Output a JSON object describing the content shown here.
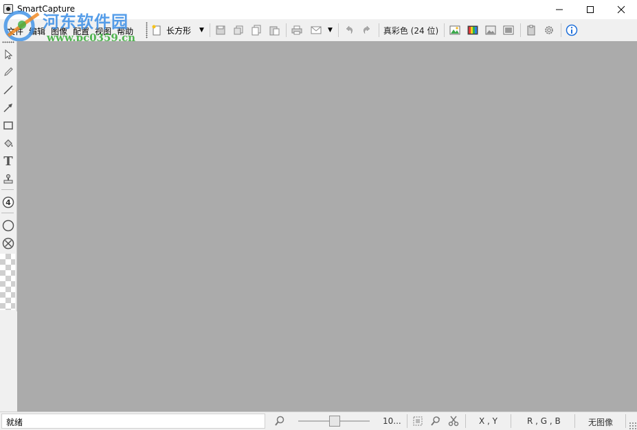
{
  "window": {
    "title": "SmartCapture",
    "controls": [
      "minimize",
      "maximize",
      "close"
    ]
  },
  "watermark": {
    "site_name": "河东软件园",
    "url": "www.pc0359.cn"
  },
  "menu": {
    "items": [
      "文件",
      "编辑",
      "图像",
      "配置",
      "视图",
      "帮助"
    ]
  },
  "toolbar": {
    "shape_selector": "长方形",
    "color_depth": "真彩色 (24 位)",
    "buttons": [
      "save-icon",
      "copy-all-icon",
      "copy-icon",
      "paste-icon",
      "print-icon",
      "email-icon",
      "undo-icon",
      "redo-icon",
      "image-adjust-icon",
      "color-balance-icon",
      "image-icon",
      "screen-icon",
      "clipboard-icon",
      "settings-icon",
      "info-icon"
    ]
  },
  "tools": [
    "select-arrow-icon",
    "pencil-icon",
    "line-icon",
    "arrow-icon",
    "rectangle-icon",
    "fill-bucket-icon",
    "text-icon",
    "stamp-icon",
    "number-icon",
    "circle-icon",
    "cross-circle-icon"
  ],
  "tool_number_label": "4",
  "tool_text_label": "T",
  "status": {
    "message": "就绪",
    "zoom": "10...",
    "zoom_level": 0.45,
    "coords": "X , Y",
    "rgb": "R , G , B",
    "image_state": "无图像"
  },
  "colors": {
    "canvas": "#ababab",
    "chrome": "#f0f0f0",
    "info_accent": "#1e6fd9"
  }
}
